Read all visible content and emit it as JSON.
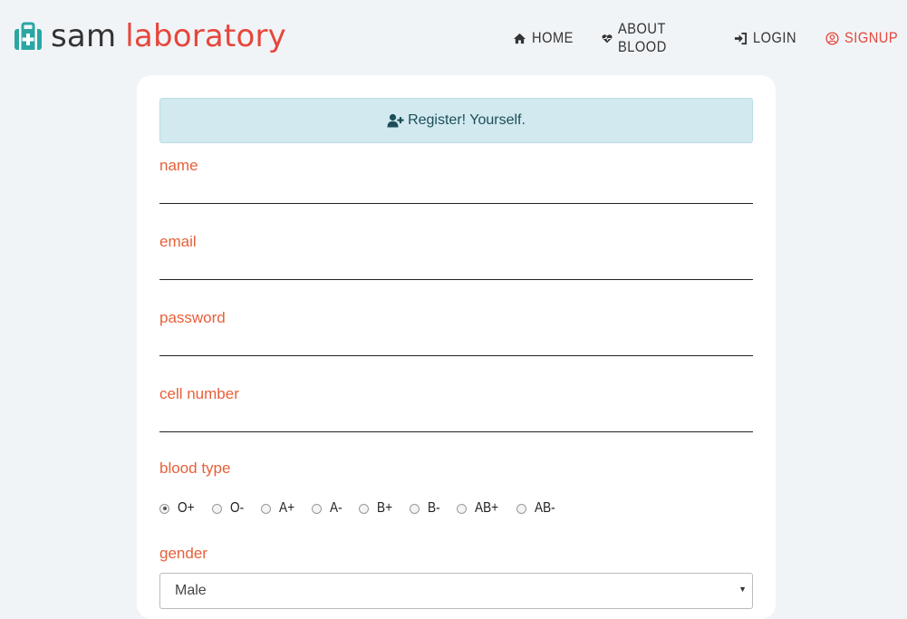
{
  "brand": {
    "name_part1": "sam",
    "name_part2": "laboratory",
    "icon": "medkit-icon"
  },
  "nav": {
    "items": [
      {
        "label": "HOME",
        "icon": "home-icon"
      },
      {
        "label": "ABOUT BLOOD",
        "icon": "heartbeat-icon"
      },
      {
        "label": "LOGIN",
        "icon": "sign-in-icon"
      },
      {
        "label": "SIGNUP",
        "icon": "user-circle-icon",
        "active": true
      }
    ]
  },
  "form": {
    "banner_text": "Register! Yourself.",
    "fields": [
      {
        "label": "name",
        "value": ""
      },
      {
        "label": "email",
        "value": ""
      },
      {
        "label": "password",
        "value": ""
      },
      {
        "label": "cell number",
        "value": ""
      }
    ],
    "blood_type": {
      "label": "blood type",
      "options": [
        "O+",
        "O-",
        "A+",
        "A-",
        "B+",
        "B-",
        "AB+",
        "AB-"
      ],
      "selected": "O+"
    },
    "gender": {
      "label": "gender",
      "selected": "Male"
    }
  },
  "colors": {
    "accent": "#e6463b",
    "label": "#e6603a",
    "banner_bg": "#d1e9ef",
    "brand_icon": "#2aa7a3"
  }
}
